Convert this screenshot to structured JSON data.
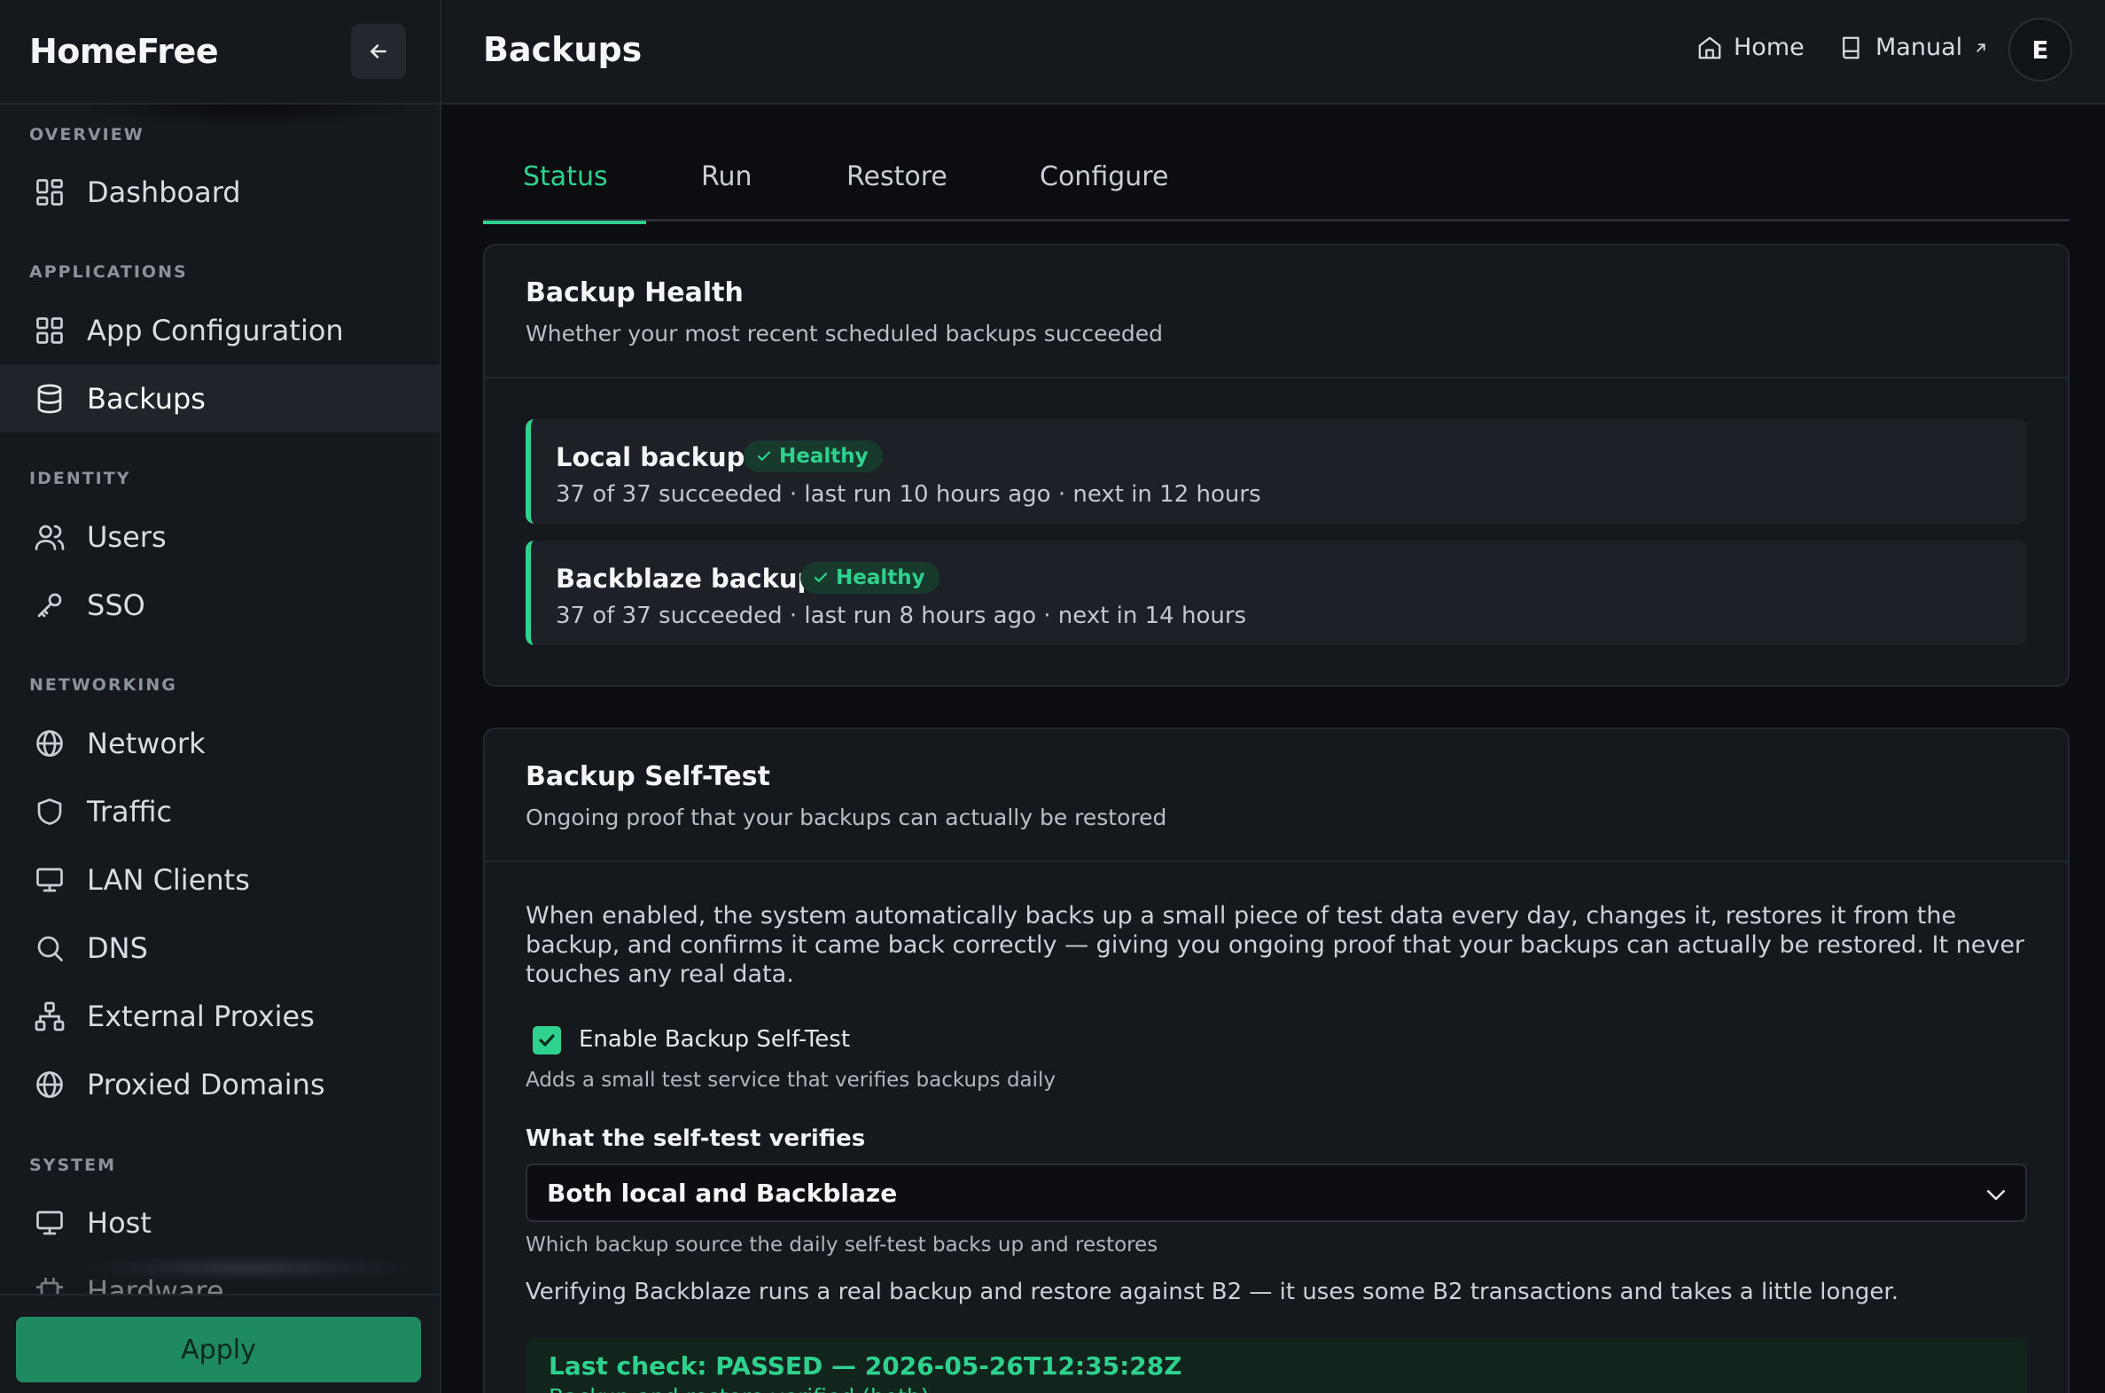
{
  "app": {
    "brand": "HomeFree",
    "page_title": "Backups"
  },
  "sidebar": {
    "sections": [
      {
        "label": "OVERVIEW"
      },
      {
        "label": "APPLICATIONS"
      },
      {
        "label": "IDENTITY"
      },
      {
        "label": "NETWORKING"
      },
      {
        "label": "SYSTEM"
      }
    ],
    "items": [
      {
        "label": "Dashboard",
        "icon": "dashboard-icon"
      },
      {
        "label": "App Configuration",
        "icon": "grid-icon"
      },
      {
        "label": "Backups",
        "icon": "database-icon",
        "active": true
      },
      {
        "label": "Users",
        "icon": "users-icon"
      },
      {
        "label": "SSO",
        "icon": "key-icon"
      },
      {
        "label": "Network",
        "icon": "globe-icon"
      },
      {
        "label": "Traffic",
        "icon": "shield-icon"
      },
      {
        "label": "LAN Clients",
        "icon": "monitor-icon"
      },
      {
        "label": "DNS",
        "icon": "search-icon"
      },
      {
        "label": "External Proxies",
        "icon": "network-icon"
      },
      {
        "label": "Proxied Domains",
        "icon": "globe-icon"
      },
      {
        "label": "Host",
        "icon": "monitor-icon"
      },
      {
        "label": "Hardware",
        "icon": "chip-icon"
      }
    ],
    "apply_label": "Apply"
  },
  "topbar": {
    "home_label": "Home",
    "manual_label": "Manual",
    "avatar_initial": "E"
  },
  "tabs": [
    {
      "label": "Status",
      "active": true
    },
    {
      "label": "Run"
    },
    {
      "label": "Restore"
    },
    {
      "label": "Configure"
    }
  ],
  "health": {
    "title": "Backup Health",
    "subtitle": "Whether your most recent scheduled backups succeeded",
    "rows": [
      {
        "name": "Local backups",
        "badge": "Healthy",
        "detail": "37 of 37 succeeded · last run 10 hours ago · next in 12 hours"
      },
      {
        "name": "Backblaze backups",
        "badge": "Healthy",
        "detail": "37 of 37 succeeded · last run 8 hours ago · next in 14 hours"
      }
    ]
  },
  "selftest": {
    "title": "Backup Self-Test",
    "subtitle": "Ongoing proof that your backups can actually be restored",
    "description": "When enabled, the system automatically backs up a small piece of test data every day, changes it, restores it from the backup, and confirms it came back correctly — giving you ongoing proof that your backups can actually be restored. It never touches any real data.",
    "enable_label": "Enable Backup Self-Test",
    "enabled": true,
    "enable_hint": "Adds a small test service that verifies backups daily",
    "verifies_label": "What the self-test verifies",
    "verifies_value": "Both local and Backblaze",
    "verifies_hint": "Which backup source the daily self-test backs up and restores",
    "b2_note": "Verifying Backblaze runs a real backup and restore against B2 — it uses some B2 transactions and takes a little longer.",
    "last_check_title": "Last check: PASSED — 2026-05-26T12:35:28Z",
    "last_check_detail": "Backup and restore verified (both)."
  },
  "colors": {
    "accent": "#2fd18e",
    "background": "#0b0d10",
    "panel": "#15181d",
    "apply": "#1f8a5f"
  }
}
